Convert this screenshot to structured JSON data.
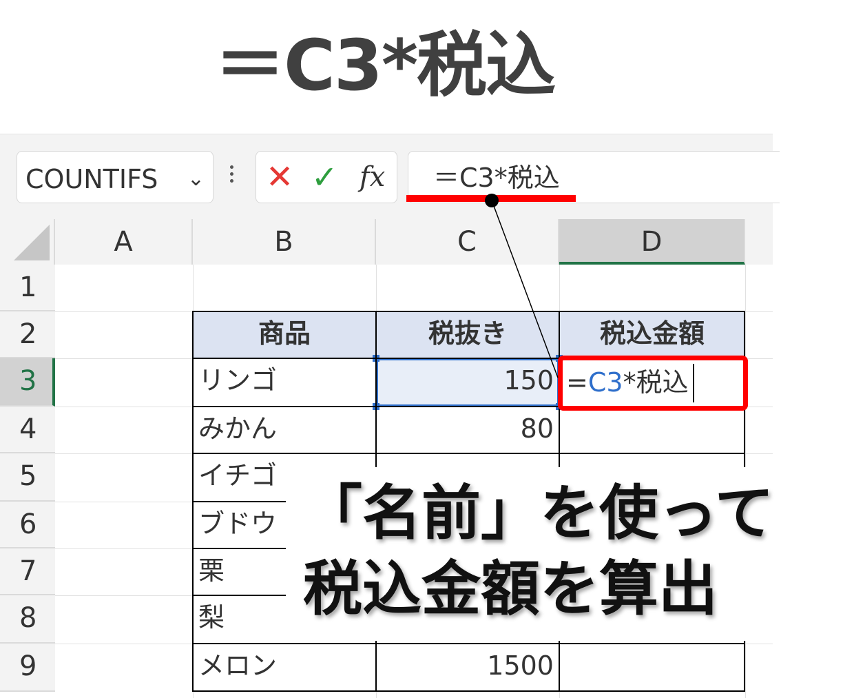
{
  "headline": "＝C3*税込",
  "toolbar": {
    "name_box": "COUNTIFS",
    "formula_bar": "＝C3*税込",
    "fx": "fx",
    "cancel": "✕",
    "enter": "✓"
  },
  "columns": [
    "A",
    "B",
    "C",
    "D"
  ],
  "rows": [
    "1",
    "2",
    "3",
    "4",
    "5",
    "6",
    "7",
    "8",
    "9"
  ],
  "table": {
    "headers": [
      "商品",
      "税抜き",
      "税込金額"
    ],
    "products": [
      "リンゴ",
      "みかん",
      "イチゴ",
      "ブドウ",
      "栗",
      "梨",
      "メロン"
    ],
    "prices": [
      "150",
      "80",
      "",
      "",
      "",
      "",
      "1500"
    ]
  },
  "active_cell": {
    "eq": "=",
    "ref": "C3",
    "rest": "*税込"
  },
  "callout": {
    "line1": "「名前」を使って",
    "line2": "税込金額を算出"
  },
  "colors": {
    "highlight_red": "#ff0000",
    "selection_blue": "#2f6fcb",
    "header_fill": "#dce3f2",
    "excel_green": "#217346"
  }
}
